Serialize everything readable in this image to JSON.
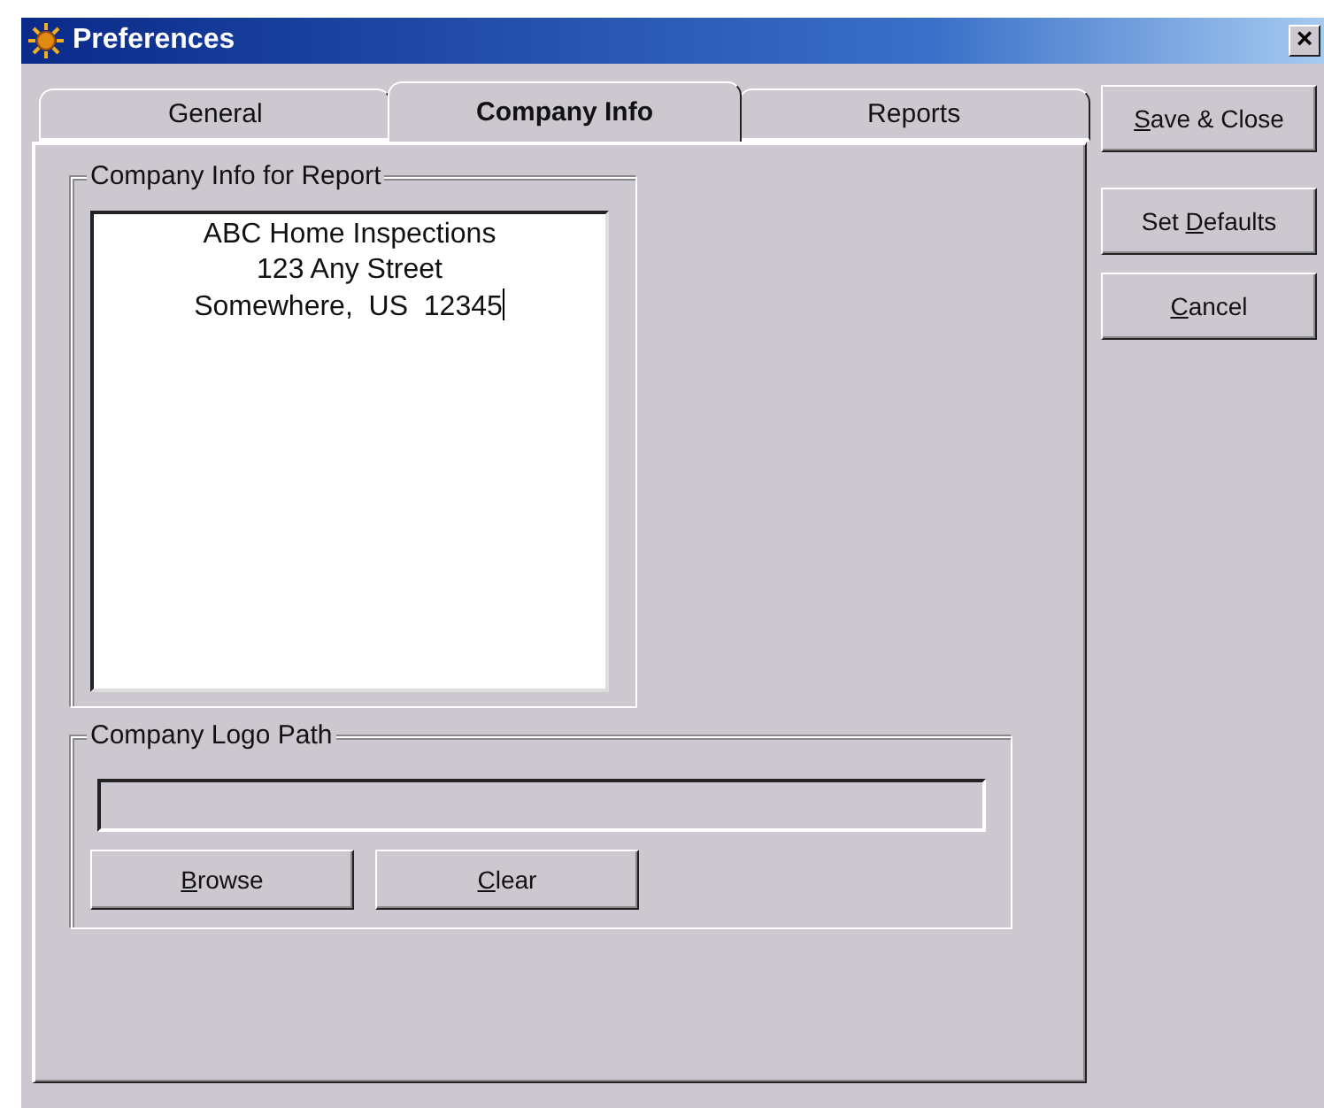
{
  "window": {
    "title": "Preferences",
    "close": "×"
  },
  "tabs": [
    {
      "label": "General",
      "selected": false
    },
    {
      "label": "Company Info",
      "selected": true
    },
    {
      "label": "Reports",
      "selected": false
    }
  ],
  "company_info": {
    "legend": "Company Info for Report",
    "lines": [
      "ABC Home Inspections",
      "123 Any Street",
      "Somewhere,  US  12345"
    ],
    "focused": true
  },
  "logo": {
    "legend": "Company Logo Path",
    "buttons": [
      {
        "access_key": "B",
        "after": "rowse"
      },
      {
        "access_key": "C",
        "after": "lear"
      }
    ]
  },
  "side_buttons": [
    {
      "access_key": "S",
      "after": "ave & Close"
    },
    {
      "before": "Set ",
      "access_key": "D",
      "after": "efaults"
    },
    {
      "access_key": "C",
      "after": "ancel"
    }
  ]
}
